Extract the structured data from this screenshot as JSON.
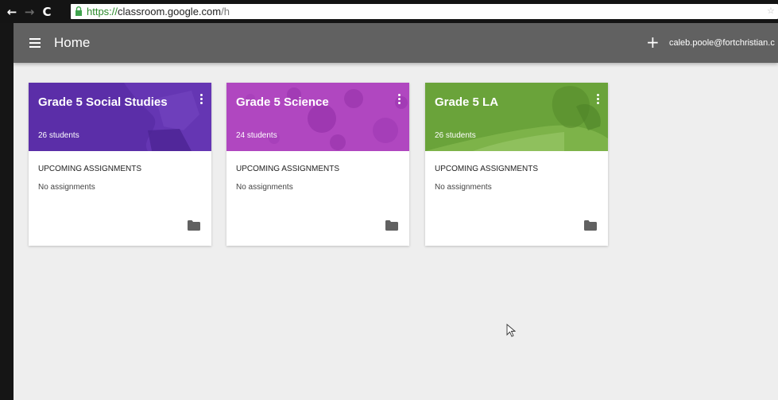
{
  "browser": {
    "url_scheme": "https://",
    "url_host": "classroom.google.com",
    "url_path": "/h",
    "url_end_glyph": "☆"
  },
  "appbar": {
    "title": "Home",
    "user_email": "caleb.poole@fortchristian.c"
  },
  "classes": [
    {
      "name": "Grade 5 Social Studies",
      "students": "26 students",
      "upcoming_label": "UPCOMING ASSIGNMENTS",
      "assignments": "No assignments",
      "theme_color": "#5a2ea6"
    },
    {
      "name": "Grade 5 Science",
      "students": "24 students",
      "upcoming_label": "UPCOMING ASSIGNMENTS",
      "assignments": "No assignments",
      "theme_color": "#b047c0"
    },
    {
      "name": "Grade 5 LA",
      "students": "26 students",
      "upcoming_label": "UPCOMING ASSIGNMENTS",
      "assignments": "No assignments",
      "theme_color": "#6aa33a"
    }
  ],
  "colors": {
    "appbar": "#616161",
    "background": "#eeeeee"
  },
  "icons": {
    "back": "arrow-left-icon",
    "forward": "arrow-right-icon",
    "reload": "reload-icon",
    "menu": "hamburger-menu-icon",
    "add": "plus-icon",
    "more": "more-vert-icon",
    "folder": "folder-icon"
  }
}
